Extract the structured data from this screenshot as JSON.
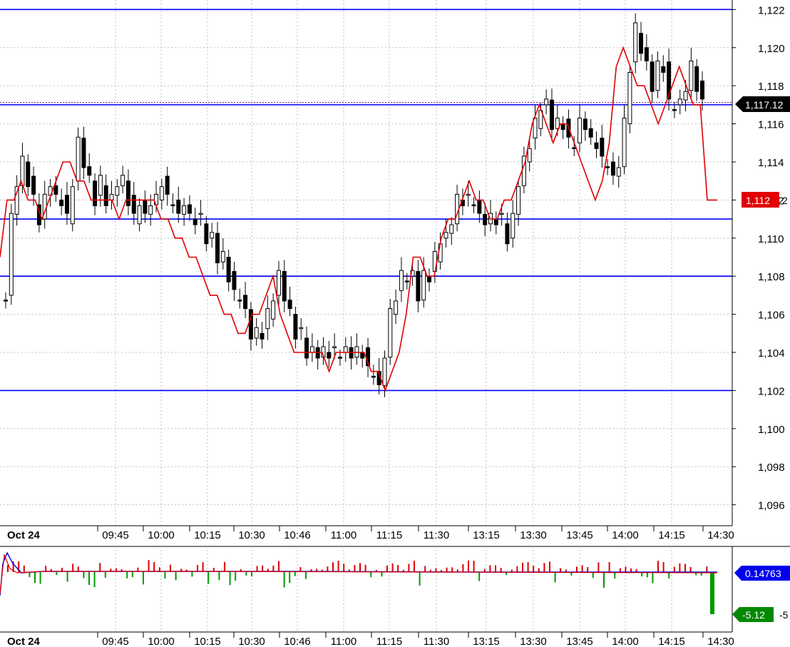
{
  "chart_data": [
    {
      "type": "candlestick",
      "panel": "price",
      "y_ticks": [
        "1,096",
        "1,098",
        "1,100",
        "1,102",
        "1,104",
        "1,106",
        "1,108",
        "1,110",
        "1,112",
        "1,114",
        "1,116",
        "1,118",
        "1,120",
        "1,122"
      ],
      "ylim": [
        1094.9,
        1122.5
      ],
      "x_labels": [
        "09:45",
        "10:00",
        "10:15",
        "10:30",
        "10:46",
        "11:00",
        "11:15",
        "11:30",
        "13:15",
        "13:30",
        "13:45",
        "14:00",
        "14:15",
        "14:30"
      ],
      "date_label": "Oct 24",
      "horizontal_levels": [
        1122.0,
        1117.0,
        1111.0,
        1108.0,
        1102.0
      ],
      "last_price_tag": "1,117.12",
      "last_price_value": 1117.12,
      "red_line_tag": "1,112",
      "red_line_tag_suffix": "2",
      "red_line_value": 1112.0,
      "candle_close_path": [
        1107,
        1111,
        1113,
        1114,
        1113,
        1112,
        1111,
        1112,
        1113,
        1112,
        1112,
        1111,
        1113,
        1115,
        1114,
        1113,
        1112,
        1113,
        1112,
        1112,
        1113,
        1113,
        1112,
        1111,
        1112,
        1111,
        1112,
        1112,
        1113,
        1112,
        1112,
        1111,
        1112,
        1111,
        1111,
        1111,
        1110,
        1110,
        1109,
        1109,
        1108,
        1107,
        1107,
        1106,
        1105,
        1105,
        1105,
        1106,
        1107,
        1108,
        1107,
        1106,
        1105,
        1105,
        1104,
        1104,
        1104,
        1104,
        1104,
        1104,
        1104,
        1104,
        1104,
        1104,
        1104,
        1103,
        1103,
        1102,
        1104,
        1106,
        1107,
        1108,
        1108,
        1108,
        1107,
        1108,
        1108,
        1109,
        1110,
        1110,
        1111,
        1112,
        1112,
        1112,
        1112,
        1111,
        1111,
        1111,
        1111,
        1111,
        1110,
        1111,
        1113,
        1114,
        1115,
        1116,
        1117,
        1117,
        1116,
        1116,
        1116,
        1115,
        1115,
        1116,
        1116,
        1115,
        1115,
        1114,
        1114,
        1113,
        1114,
        1116,
        1119,
        1121,
        1120,
        1119,
        1118,
        1119,
        1119,
        1117,
        1117,
        1117,
        1118,
        1119,
        1118,
        1117
      ],
      "red_line_path": [
        1109,
        1112,
        1112,
        1113,
        1112,
        1112,
        1111,
        1112,
        1113,
        1114,
        1114,
        1113,
        1113,
        1112,
        1112,
        1112,
        1112,
        1111,
        1112,
        1112,
        1112,
        1112,
        1112,
        1111,
        1111,
        1110,
        1110,
        1109,
        1109,
        1108,
        1107,
        1107,
        1106,
        1106,
        1105,
        1105,
        1106,
        1106,
        1107,
        1108,
        1106,
        1105,
        1104,
        1104,
        1104,
        1104,
        1104,
        1103,
        1104,
        1104,
        1104,
        1104,
        1104,
        1103,
        1103,
        1102,
        1103,
        1104,
        1106,
        1109,
        1109,
        1108,
        1108,
        1110,
        1111,
        1111,
        1112,
        1113,
        1112,
        1112,
        1111,
        1111,
        1112,
        1112,
        1113,
        1114,
        1116,
        1117,
        1116,
        1115,
        1116,
        1116,
        1115,
        1114,
        1113,
        1112,
        1113,
        1115,
        1119,
        1120,
        1119,
        1118,
        1118,
        1117,
        1116,
        1117,
        1118,
        1119,
        1118,
        1117,
        1117,
        1112
      ]
    },
    {
      "type": "bar",
      "panel": "indicator",
      "line_value_tag": "0.14763",
      "line_value": 0.14763,
      "bar_value_tag": "-5.12",
      "bar_value": -5.12,
      "axis_tick": "-5",
      "date_label": "Oct 24",
      "x_labels": [
        "09:45",
        "10:00",
        "10:15",
        "10:30",
        "10:46",
        "11:00",
        "11:15",
        "11:30",
        "13:15",
        "13:30",
        "13:45",
        "14:00",
        "14:15",
        "14:30"
      ]
    }
  ],
  "colors": {
    "background": "#ffffff",
    "grid": "#c0c0c0",
    "level_line": "#0000ff",
    "red_line": "#e00000",
    "candle_up": "#ffffff",
    "candle_down": "#000000",
    "last_tag_bg": "#000000",
    "red_tag_bg": "#e00000",
    "blue_tag_bg": "#0000ee",
    "green_tag_bg": "#008800",
    "hist_up": "#dd0000",
    "hist_down": "#009900"
  }
}
